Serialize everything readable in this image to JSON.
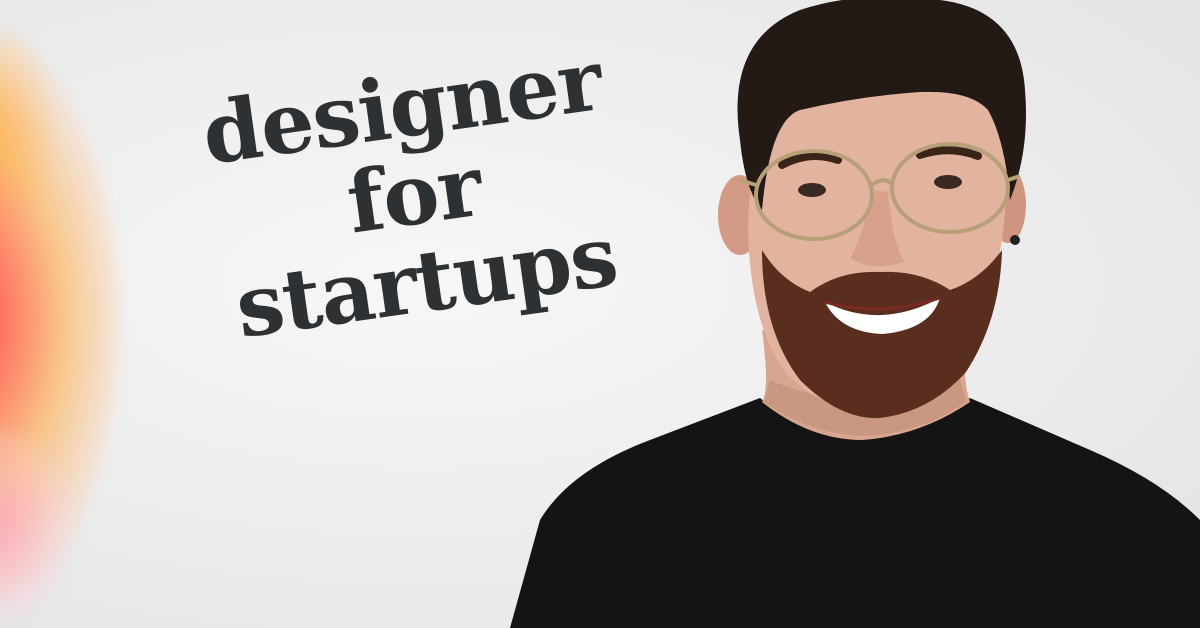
{
  "headline": {
    "line1": "designer",
    "line2": "for",
    "line3": "startups"
  },
  "colors": {
    "text": "#2d3133",
    "background": "#ececec",
    "glow": "#ff4a3d"
  },
  "photo": {
    "subject": "portrait-of-smiling-man-with-glasses"
  }
}
